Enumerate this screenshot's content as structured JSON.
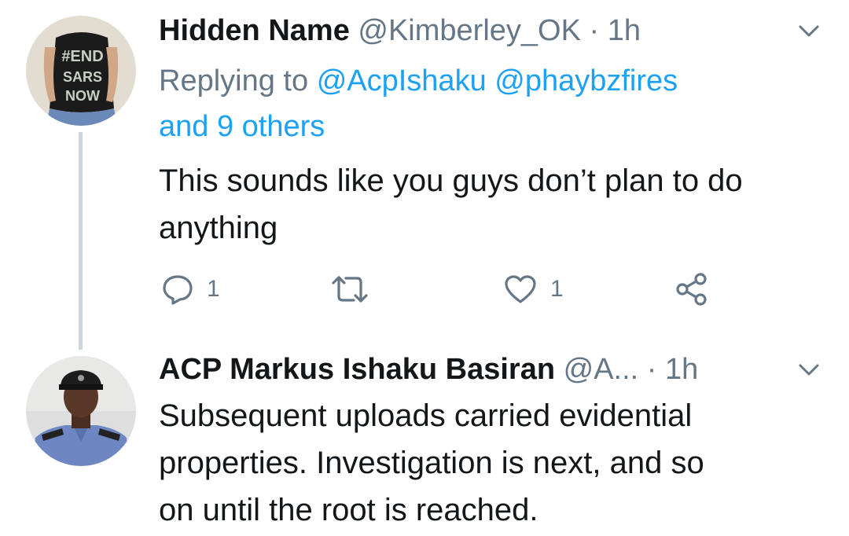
{
  "tweets": [
    {
      "display_name": "Hidden Name",
      "handle": "@Kimberley_OK",
      "separator": "·",
      "time": "1h",
      "replying_prefix": "Replying to",
      "replying_mentions": [
        "@AcpIshaku",
        "@phaybzfires"
      ],
      "replying_others": "and 9 others",
      "text_line1": "This sounds like you guys don’t plan to do",
      "text_line2": "anything",
      "reply_count": "1",
      "like_count": "1",
      "avatar_shirt_text": "#END SARS NOW"
    },
    {
      "display_name": "ACP Markus Ishaku Basiran",
      "handle": "@A...",
      "separator": "·",
      "time": "1h",
      "text_line1": "Subsequent uploads carried evidential",
      "text_line2": "properties. Investigation is next, and so",
      "text_line3": "on until the root is reached."
    }
  ],
  "icons": [
    "reply-icon",
    "retweet-icon",
    "like-icon",
    "share-icon",
    "chevron-down-icon"
  ],
  "colors": {
    "text": "#14171a",
    "secondary": "#657786",
    "link": "#1da1f2",
    "thread_line": "#ccd6dd",
    "background": "#ffffff"
  }
}
